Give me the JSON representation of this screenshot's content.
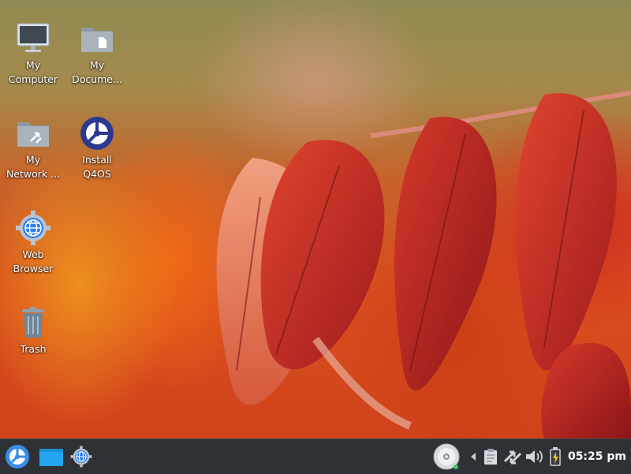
{
  "desktop": {
    "icons": [
      {
        "label": "My\nComputer",
        "icon": "computer-icon"
      },
      {
        "label": "My\nDocume...",
        "icon": "documents-folder-icon"
      },
      {
        "label": "My\nNetwork ...",
        "icon": "network-folder-icon"
      },
      {
        "label": "Install\nQ4OS",
        "icon": "q4os-installer-icon"
      },
      {
        "label": "Web\nBrowser",
        "icon": "web-browser-icon"
      },
      {
        "label": "Trash",
        "icon": "trash-icon"
      }
    ]
  },
  "taskbar": {
    "items": [
      "start-menu-icon",
      "show-desktop-icon",
      "web-browser-launcher-icon"
    ],
    "tray": [
      "disc-icon",
      "tray-expand-arrow-icon",
      "clipboard-icon",
      "network-icon",
      "volume-icon",
      "battery-icon"
    ],
    "clock": "05:25 pm"
  },
  "colors": {
    "taskbar_bg": "#2e3237",
    "accent_blue": "#2f80ed"
  }
}
